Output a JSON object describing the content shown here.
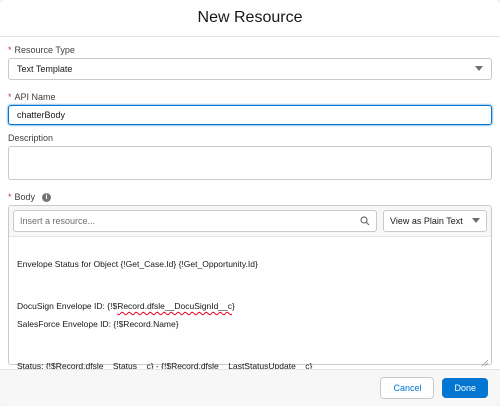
{
  "modal": {
    "title": "New Resource"
  },
  "resource_type": {
    "label": "Resource Type",
    "required_marker": "*",
    "value": "Text Template"
  },
  "api_name": {
    "label": "API Name",
    "required_marker": "*",
    "value": "chatterBody"
  },
  "description": {
    "label": "Description",
    "value": ""
  },
  "body": {
    "label": "Body",
    "required_marker": "*",
    "info_glyph": "i",
    "search_placeholder": "Insert a resource...",
    "view_mode": "View as Plain Text",
    "lines": {
      "l1": "Envelope Status for Object {!Get_Case.Id}  {!Get_Opportunity.Id}",
      "l2a": "DocuSign Envelope ID: {!$",
      "l2b": "Record.dfsle__DocuSignId__c",
      "l2c": "}",
      "l3": "SalesForce Envelope ID: {!$Record.Name}",
      "l4a": "Status: {!$",
      "l4b": "Record.dfsle__Status__c",
      "l4c": "} - {!$",
      "l4d": "Record.dfsle__LastStatusUpdate__c",
      "l4e": "}"
    }
  },
  "footer": {
    "cancel": "Cancel",
    "done": "Done"
  },
  "colors": {
    "brand": "#0176d3",
    "required": "#c23934"
  }
}
